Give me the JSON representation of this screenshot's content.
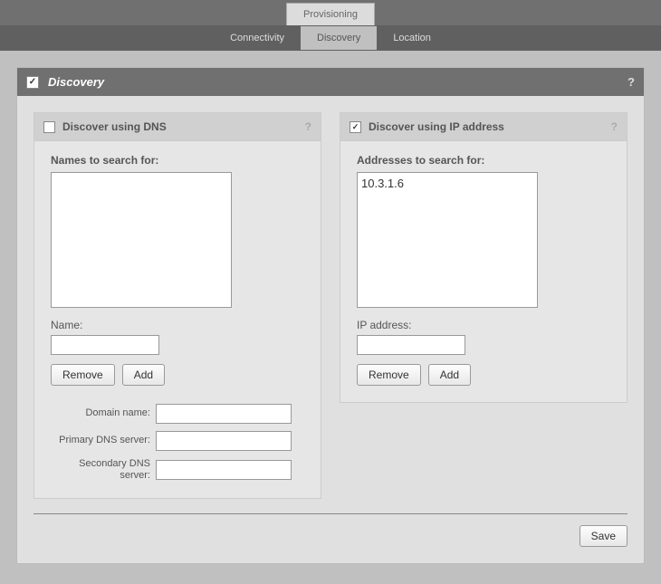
{
  "topTab": "Provisioning",
  "subTabs": {
    "connectivity": "Connectivity",
    "discovery": "Discovery",
    "location": "Location"
  },
  "panel": {
    "title": "Discovery",
    "checked": true,
    "help": "?"
  },
  "dns": {
    "title": "Discover using DNS",
    "checked": false,
    "help": "?",
    "listLabel": "Names to search for:",
    "listItems": [],
    "nameLabel": "Name:",
    "nameValue": "",
    "removeBtn": "Remove",
    "addBtn": "Add",
    "domainLabel": "Domain name:",
    "domainValue": "",
    "primaryLabel": "Primary DNS server:",
    "primaryValue": "",
    "secondaryLabel": "Secondary DNS server:",
    "secondaryValue": ""
  },
  "ip": {
    "title": "Discover using IP address",
    "checked": true,
    "help": "?",
    "listLabel": "Addresses to search for:",
    "listItems": [
      "10.3.1.6"
    ],
    "addrLabel": "IP address:",
    "addrValue": "",
    "removeBtn": "Remove",
    "addBtn": "Add"
  },
  "saveBtn": "Save"
}
